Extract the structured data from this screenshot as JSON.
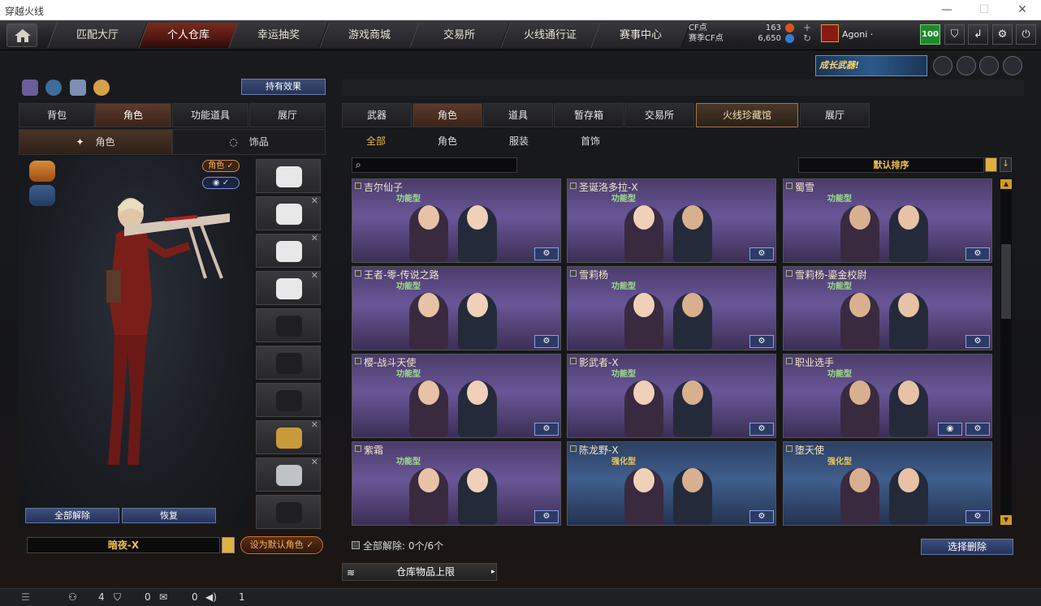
{
  "window": {
    "title": "穿越火线",
    "minimize": "—",
    "maximize": "☐",
    "close": "✕"
  },
  "nav": {
    "tabs": [
      {
        "label": "匹配大厅"
      },
      {
        "label": "个人仓库"
      },
      {
        "label": "幸运抽奖"
      },
      {
        "label": "游戏商城"
      },
      {
        "label": "交易所"
      },
      {
        "label": "火线通行证"
      },
      {
        "label": "赛事中心"
      }
    ],
    "active_tab": "个人仓库"
  },
  "currency": {
    "cf_label": "CF点",
    "cf_value": "163",
    "event_cf_label": "赛季CF点",
    "event_cf_value": "6,650"
  },
  "user": {
    "name": "Agoni ·",
    "level": "100"
  },
  "promo": {
    "text": "成长武器!"
  },
  "left": {
    "effects_button": "持有效果",
    "tabs": [
      "背包",
      "角色",
      "功能道具",
      "展厅"
    ],
    "active_tab": "角色",
    "subtabs": [
      "角色",
      "饰品"
    ],
    "active_subtab": "角色",
    "role_pill": "角色 ✓",
    "eye_pill": "✓",
    "unequip_all": "全部解除",
    "restore": "恢复",
    "character_name": "暗夜-X",
    "set_default": "设为默认角色 ✓",
    "slots": [
      {
        "label": "sniper-rifle",
        "closable": false
      },
      {
        "label": "headphones",
        "closable": true
      },
      {
        "label": "goggles",
        "closable": true
      },
      {
        "label": "radio",
        "closable": true
      },
      {
        "label": "vest-empty",
        "closable": false
      },
      {
        "label": "body-empty",
        "closable": false
      },
      {
        "label": "pants-empty",
        "closable": false
      },
      {
        "label": "gold-dragon",
        "closable": true
      },
      {
        "label": "silver-dragon",
        "closable": true
      },
      {
        "label": "ring-empty",
        "closable": false
      }
    ]
  },
  "right": {
    "tabs": [
      "武器",
      "角色",
      "道具",
      "暂存箱",
      "交易所",
      "火线珍藏馆",
      "展厅"
    ],
    "active_tab": "角色",
    "filters": [
      "全部",
      "角色",
      "服装",
      "首饰"
    ],
    "active_filter": "全部",
    "sort_label": "默认排序",
    "cards": [
      {
        "name": "吉尔仙子",
        "type": "功能型",
        "theme": "purple",
        "gold": false
      },
      {
        "name": "圣诞洛多拉-X",
        "type": "功能型",
        "theme": "purple",
        "gold": false
      },
      {
        "name": "蜀雪",
        "type": "功能型",
        "theme": "purple",
        "gold": false
      },
      {
        "name": "王者-零-传说之路",
        "type": "功能型",
        "theme": "purple",
        "gold": false
      },
      {
        "name": "雪莉杨",
        "type": "功能型",
        "theme": "purple",
        "gold": false
      },
      {
        "name": "雪莉杨-鎏金校尉",
        "type": "功能型",
        "theme": "purple",
        "gold": false
      },
      {
        "name": "樱-战斗天使",
        "type": "功能型",
        "theme": "purple",
        "gold": false
      },
      {
        "name": "影武者-X",
        "type": "功能型",
        "theme": "purple",
        "gold": false
      },
      {
        "name": "职业选手",
        "type": "功能型",
        "theme": "purple",
        "gold": false
      },
      {
        "name": "紫霜",
        "type": "功能型",
        "theme": "purple",
        "gold": false
      },
      {
        "name": "陈龙野-X",
        "type": "强化型",
        "theme": "blue",
        "gold": true
      },
      {
        "name": "堕天使",
        "type": "强化型",
        "theme": "blue",
        "gold": true
      }
    ],
    "unequip_info": "全部解除: 0个/6个",
    "select_delete": "选择删除",
    "storage_limit": "仓库物品上限"
  },
  "status": {
    "item1": "4",
    "item2": "0",
    "item3": "0",
    "item4": "1"
  }
}
